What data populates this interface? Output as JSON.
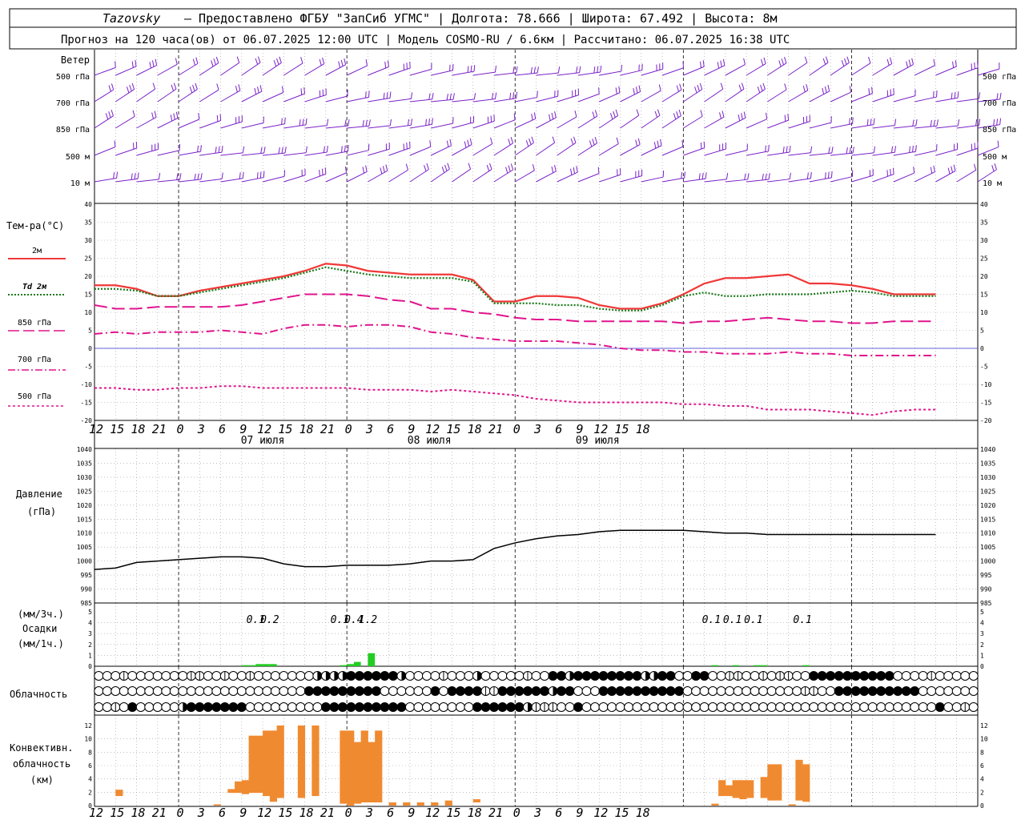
{
  "header": {
    "line1_station": "Tazovsky",
    "line1_rest": "– Предоставлено ФГБУ \"ЗапСиб УГМС\" | Долгота: 78.666 | Широта: 67.492 | Высота: 8м",
    "line2": "Прогноз на 120 часа(ов) от 06.07.2025 12:00 UTC  | Модель COSMO-RU / 6.6км | Рассчитано: 06.07.2025 16:38 UTC"
  },
  "labels": {
    "wind_title": "Ветер",
    "wind_levels": [
      "500 гПа",
      "700 гПа",
      "850 гПа",
      "500 м",
      "10  м"
    ],
    "temp_title": "Тем-ра(°C)",
    "temp_legend": [
      "2м",
      "Td 2м",
      "850 гПа",
      "700 гПа",
      "500 гПа"
    ],
    "pressure_title": "Давление",
    "pressure_unit": "(гПа)",
    "precip_unit1": "(мм/3ч.)",
    "precip_title": "Осадки",
    "precip_unit2": "(мм/1ч.)",
    "cloud_title": "Облачность",
    "conv_title1": "Конвективн.",
    "conv_title2": "облачность",
    "conv_unit": "(км)"
  },
  "colors": {
    "wind": "#7a22c8",
    "t2m": "#f03838",
    "td2m": "#1a7a1a",
    "levels": "#e0148c",
    "zero_line": "#3030d0",
    "precip": "#22cc22",
    "convective": "#f08a30"
  },
  "chart_data": [
    {
      "type": "line",
      "name": "temperature",
      "x_hours_from_start": [
        0,
        3,
        6,
        9,
        12,
        15,
        18,
        21,
        24,
        27,
        30,
        33,
        36,
        39,
        42,
        45,
        48,
        51,
        54,
        57,
        60,
        63,
        66,
        69,
        72,
        75,
        78,
        81,
        84,
        87,
        90,
        93,
        96,
        99,
        102,
        105,
        108,
        111,
        114,
        117,
        120
      ],
      "series": [
        {
          "name": "2м",
          "values": [
            17.5,
            17.5,
            16.5,
            14.5,
            14.5,
            16,
            17,
            18,
            19,
            20,
            21.5,
            23.5,
            23,
            21.5,
            21,
            20.5,
            20.5,
            20.5,
            19,
            13,
            13,
            14.5,
            14.5,
            14,
            12,
            11,
            11,
            12.5,
            15,
            18,
            19.5,
            19.5,
            20,
            20.5,
            18,
            18,
            17.5,
            16.5,
            15,
            15,
            15
          ]
        },
        {
          "name": "Td 2м",
          "values": [
            16.5,
            16.5,
            16,
            14.5,
            14.5,
            15.5,
            16.5,
            17.5,
            18.5,
            19.5,
            21,
            22.5,
            21.5,
            20.5,
            20,
            19.5,
            19.5,
            19.5,
            18.5,
            12.5,
            12.5,
            12.5,
            12,
            12,
            11,
            10.5,
            10.5,
            12,
            14.5,
            15.5,
            14.5,
            14.5,
            15,
            15,
            15,
            15.5,
            16,
            15.5,
            14.5,
            14.5,
            14.5
          ]
        },
        {
          "name": "850 гПа",
          "values": [
            12,
            11,
            11,
            11.5,
            11.5,
            11.5,
            11.5,
            12,
            13,
            14,
            15,
            15,
            15,
            14.5,
            13.5,
            13,
            11,
            11,
            10,
            9.5,
            8.5,
            8,
            8,
            7.5,
            7.5,
            7.5,
            7.5,
            7.5,
            7,
            7.5,
            7.5,
            8,
            8.5,
            8,
            7.5,
            7.5,
            7,
            7,
            7.5,
            7.5,
            7.5
          ]
        },
        {
          "name": "700 гПа",
          "values": [
            4,
            4.5,
            4,
            4.5,
            4.5,
            4.5,
            5,
            4.5,
            4,
            5.5,
            6.5,
            6.5,
            6,
            6.5,
            6.5,
            6,
            4.5,
            4,
            3,
            2.5,
            2,
            2,
            2,
            1.5,
            1,
            0,
            -0.5,
            -0.5,
            -1,
            -1,
            -1.5,
            -1.5,
            -1.5,
            -1,
            -1.5,
            -1.5,
            -2,
            -2,
            -2,
            -2,
            -2
          ]
        },
        {
          "name": "500 гПа",
          "values": [
            -11,
            -11,
            -11.5,
            -11.5,
            -11,
            -11,
            -10.5,
            -10.5,
            -11,
            -11,
            -11,
            -11,
            -11,
            -11.5,
            -11.5,
            -11.5,
            -12,
            -11.5,
            -12,
            -12.5,
            -13,
            -14,
            -14.5,
            -15,
            -15,
            -15,
            -15,
            -15,
            -15.5,
            -15.5,
            -16,
            -16,
            -17,
            -17,
            -17,
            -17.5,
            -18,
            -18.5,
            -17.5,
            -17,
            -17
          ]
        }
      ],
      "ylim": [
        -20,
        40
      ]
    },
    {
      "type": "line",
      "name": "pressure",
      "x_hours_from_start": [
        0,
        3,
        6,
        9,
        12,
        15,
        18,
        21,
        24,
        27,
        30,
        33,
        36,
        39,
        42,
        45,
        48,
        51,
        54,
        57,
        60,
        63,
        66,
        69,
        72,
        75,
        78,
        81,
        84,
        87,
        90,
        93,
        96,
        99,
        102,
        105,
        108,
        111,
        114,
        117,
        120
      ],
      "values": [
        997,
        997.5,
        999.5,
        1000,
        1000.5,
        1001,
        1001.5,
        1001.5,
        1001,
        999,
        998,
        998,
        998.5,
        998.5,
        998.5,
        999,
        1000,
        1000,
        1000.5,
        1004.5,
        1006.5,
        1008,
        1009,
        1009.5,
        1010.5,
        1011,
        1011,
        1011,
        1011,
        1010.5,
        1010,
        1010,
        1009.5,
        1009.5,
        1009.5,
        1009.5,
        1009.5,
        1009.5,
        1009.5,
        1009.5,
        1009.5
      ],
      "ylim": [
        985,
        1040
      ]
    },
    {
      "type": "bar",
      "name": "precipitation",
      "bars": [
        {
          "hour": 21,
          "value": 0.1
        },
        {
          "hour": 22,
          "value": 0.1
        },
        {
          "hour": 23,
          "value": 0.2
        },
        {
          "hour": 24,
          "value": 0.2
        },
        {
          "hour": 25,
          "value": 0.2
        },
        {
          "hour": 35,
          "value": 0.1
        },
        {
          "hour": 36,
          "value": 0.2
        },
        {
          "hour": 37,
          "value": 0.4
        },
        {
          "hour": 39,
          "value": 1.2
        },
        {
          "hour": 88,
          "value": 0.1
        },
        {
          "hour": 91,
          "value": 0.1
        },
        {
          "hour": 94,
          "value": 0.1
        },
        {
          "hour": 95,
          "value": 0.1
        },
        {
          "hour": 101,
          "value": 0.1
        }
      ],
      "totals": [
        {
          "hour": 23,
          "label": "0.1"
        },
        {
          "hour": 25,
          "label": "0.2"
        },
        {
          "hour": 35,
          "label": "0.1"
        },
        {
          "hour": 37,
          "label": "0.4"
        },
        {
          "hour": 39,
          "label": "1.2"
        },
        {
          "hour": 88,
          "label": "0.1"
        },
        {
          "hour": 91,
          "label": "0.1"
        },
        {
          "hour": 94,
          "label": "0.1"
        },
        {
          "hour": 101,
          "label": "0.1"
        }
      ],
      "ylim": [
        0,
        5
      ]
    },
    {
      "type": "bar",
      "name": "convective_cloud",
      "bars": [
        {
          "hour": 3,
          "bottom": 1.5,
          "top": 2.5
        },
        {
          "hour": 17,
          "bottom": 0,
          "top": 0.2
        },
        {
          "hour": 19,
          "bottom": 2,
          "top": 2.6
        },
        {
          "hour": 20,
          "bottom": 2,
          "top": 3.8
        },
        {
          "hour": 21,
          "bottom": 1.8,
          "top": 4
        },
        {
          "hour": 22,
          "bottom": 2,
          "top": 11
        },
        {
          "hour": 23,
          "bottom": 2,
          "top": 11
        },
        {
          "hour": 24,
          "bottom": 1.5,
          "top": 11.8
        },
        {
          "hour": 25,
          "bottom": 0.6,
          "top": 11.8
        },
        {
          "hour": 26,
          "bottom": 1.2,
          "top": 12.6
        },
        {
          "hour": 29,
          "bottom": 1.2,
          "top": 12.6
        },
        {
          "hour": 31,
          "bottom": 1.5,
          "top": 12.6
        },
        {
          "hour": 35,
          "bottom": 0.3,
          "top": 11.8
        },
        {
          "hour": 36,
          "bottom": 0,
          "top": 11.8
        },
        {
          "hour": 37,
          "bottom": 0.3,
          "top": 10
        },
        {
          "hour": 38,
          "bottom": 0.5,
          "top": 11.8
        },
        {
          "hour": 39,
          "bottom": 0.5,
          "top": 10
        },
        {
          "hour": 40,
          "bottom": 0.5,
          "top": 11.8
        },
        {
          "hour": 42,
          "bottom": 0,
          "top": 0.5
        },
        {
          "hour": 44,
          "bottom": 0,
          "top": 0.5
        },
        {
          "hour": 46,
          "bottom": 0,
          "top": 0.5
        },
        {
          "hour": 48,
          "bottom": 0,
          "top": 0.5
        },
        {
          "hour": 50,
          "bottom": 0,
          "top": 0.8
        },
        {
          "hour": 54,
          "bottom": 0.5,
          "top": 1
        },
        {
          "hour": 88,
          "bottom": 0,
          "top": 0.3
        },
        {
          "hour": 89,
          "bottom": 1.5,
          "top": 4
        },
        {
          "hour": 90,
          "bottom": 1.5,
          "top": 3.2
        },
        {
          "hour": 91,
          "bottom": 1.2,
          "top": 4
        },
        {
          "hour": 92,
          "bottom": 1,
          "top": 4
        },
        {
          "hour": 93,
          "bottom": 1.2,
          "top": 4
        },
        {
          "hour": 95,
          "bottom": 1.2,
          "top": 4.5
        },
        {
          "hour": 96,
          "bottom": 0.8,
          "top": 6.5
        },
        {
          "hour": 97,
          "bottom": 0.8,
          "top": 6.5
        },
        {
          "hour": 99,
          "bottom": 0,
          "top": 0.2
        },
        {
          "hour": 100,
          "bottom": 0.8,
          "top": 7.2
        },
        {
          "hour": 101,
          "bottom": 0.6,
          "top": 6.5
        }
      ],
      "ylim": [
        0,
        14
      ]
    },
    {
      "type": "heatmap",
      "name": "cloud_cover",
      "rows": 3,
      "row_values": [
        "0001000000011001001000000022223333332000010002000001003323333333322330033001100101100333333333300001000000",
        "0000000000000000000000000333333333000000303333113333332330003333333333000000000000001100333333333300000000",
        "0010300000233333330000000003333333333000000003333332111003000000000000000000000000000000000000000000300100"
      ]
    },
    {
      "type": "scatter",
      "name": "wind_barbs",
      "levels": [
        "500 гПа",
        "700 гПа",
        "850 гПа",
        "500 м",
        "10  м"
      ]
    }
  ],
  "axes": {
    "x_start_hour": 12,
    "x_total_hours": 126,
    "x_tick_labels": [
      "12",
      "15",
      "18",
      "21",
      "0",
      "3",
      "6",
      "9",
      "12",
      "15",
      "18",
      "21",
      "0",
      "3",
      "6",
      "9",
      "12",
      "15",
      "18",
      "21",
      "0",
      "3",
      "6",
      "9",
      "12",
      "15",
      "18"
    ],
    "date_labels": [
      {
        "hour": 24,
        "label": "07 июля"
      },
      {
        "hour": 48,
        "label": "08 июля"
      },
      {
        "hour": 72,
        "label": "09 июля"
      }
    ],
    "temp_ticks": [
      "40",
      "35",
      "30",
      "25",
      "20",
      "15",
      "10",
      "5",
      "0",
      "-5",
      "-10",
      "-15",
      "-20"
    ],
    "pressure_ticks": [
      "1040",
      "1035",
      "1030",
      "1025",
      "1020",
      "1015",
      "1010",
      "1005",
      "1000",
      "995",
      "990",
      "985"
    ],
    "precip_ticks": [
      "5",
      "4",
      "3",
      "2",
      "1",
      "0"
    ],
    "precip_ticks_left": [
      "5",
      "4",
      "3",
      "2",
      "1",
      "0"
    ],
    "conv_ticks": [
      "12",
      "10",
      "8",
      "6",
      "4",
      "2",
      "0"
    ]
  }
}
